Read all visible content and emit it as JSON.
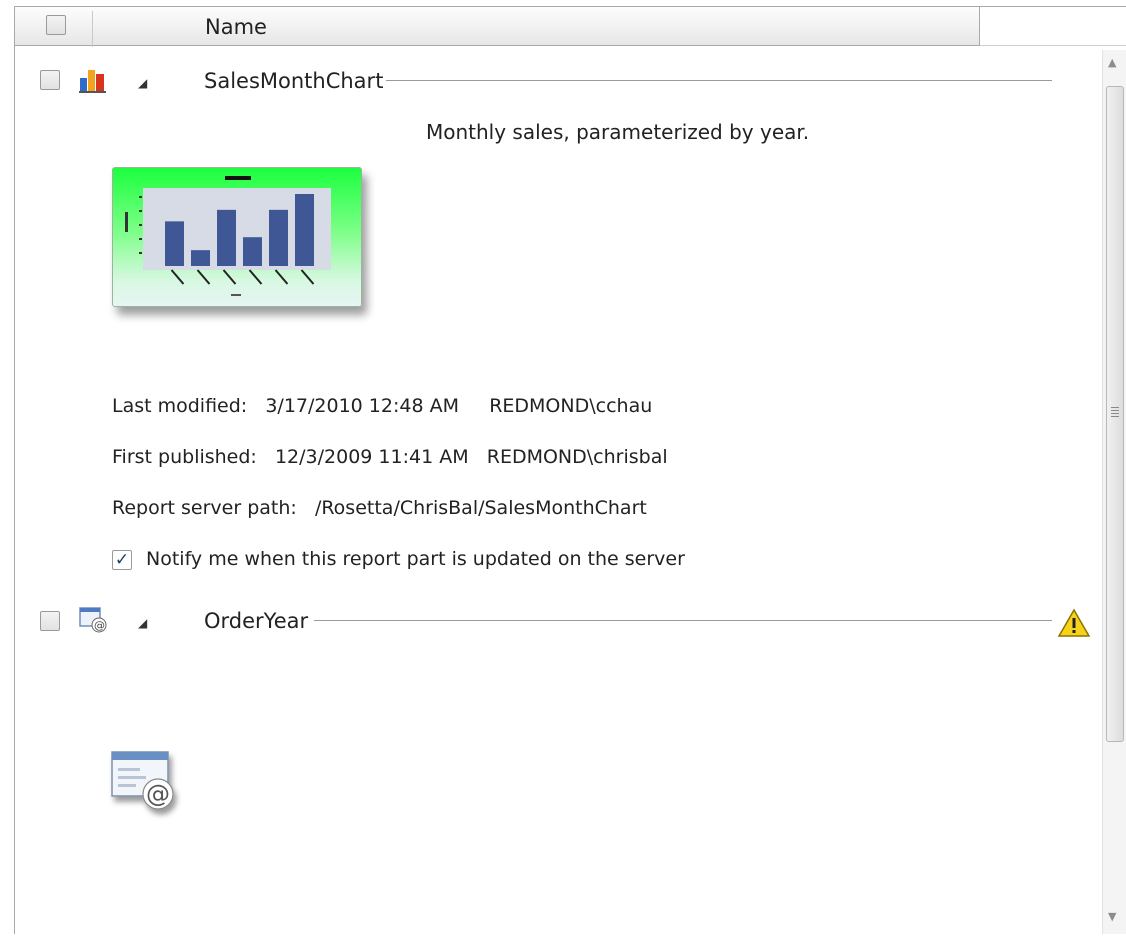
{
  "columns": {
    "name_header": "Name"
  },
  "parts": [
    {
      "title": "SalesMonthChart",
      "icon": "chart-icon",
      "description": "Monthly sales, parameterized by year.",
      "thumbnail_bars": [
        0.62,
        0.22,
        0.78,
        0.4,
        0.78,
        1.0
      ],
      "last_modified_label": "Last modified:",
      "last_modified_value": "3/17/2010 12:48 AM",
      "last_modified_user": "REDMOND\\cchau",
      "first_published_label": "First published:",
      "first_published_value": "12/3/2009 11:41 AM",
      "first_published_user": "REDMOND\\chrisbal",
      "path_label": "Report server path:",
      "path_value": "/Rosetta/ChrisBal/SalesMonthChart",
      "notify_label": "Notify me when this report part is updated on the server",
      "notify_checked": true
    },
    {
      "title": "OrderYear",
      "icon": "dataset-parameter-icon",
      "status_icon": "warning-icon"
    }
  ],
  "colors": {
    "thumbnail_bar": "#3f5795",
    "thumbnail_top": "#1cff3f",
    "warning": "#f2c500"
  }
}
